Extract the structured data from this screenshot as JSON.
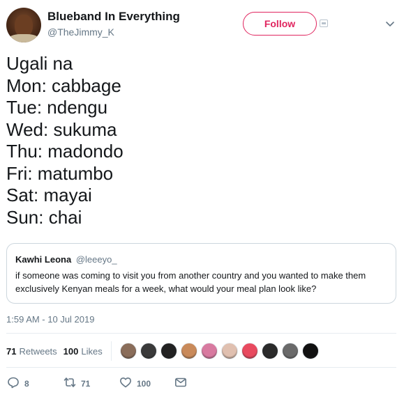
{
  "author": {
    "name": "Blueband In Everything",
    "handle": "@TheJimmy_K"
  },
  "follow_label": "Follow",
  "tweet_lines": [
    "Ugali na",
    "Mon: cabbage",
    "Tue: ndengu",
    "Wed: sukuma",
    "Thu: madondo",
    "Fri: matumbo",
    "Sat: mayai",
    "Sun: chai"
  ],
  "quoted": {
    "name": "Kawhi Leona",
    "handle": "@leeeyo_",
    "text": "if someone was coming to visit you from another country and you wanted to make them exclusively Kenyan meals for a week, what would your meal plan look like?"
  },
  "timestamp": "1:59 AM - 10 Jul 2019",
  "stats": {
    "retweets_count": "71",
    "retweets_label": "Retweets",
    "likes_count": "100",
    "likes_label": "Likes"
  },
  "liker_avatar_colors": [
    "#8a6d5a",
    "#3a3a3a",
    "#222222",
    "#c98a5a",
    "#d87aa0",
    "#e0c0b0",
    "#e84a5f",
    "#2b2b2b",
    "#6a6a6a",
    "#111111"
  ],
  "actions": {
    "reply_count": "8",
    "retweet_count": "71",
    "like_count": "100"
  },
  "colors": {
    "accent": "#e0245e",
    "secondary_text": "#657786",
    "border": "#ccd6dd"
  },
  "icons": [
    "chevron-down-icon",
    "reply-icon",
    "retweet-icon",
    "like-icon",
    "message-icon"
  ]
}
